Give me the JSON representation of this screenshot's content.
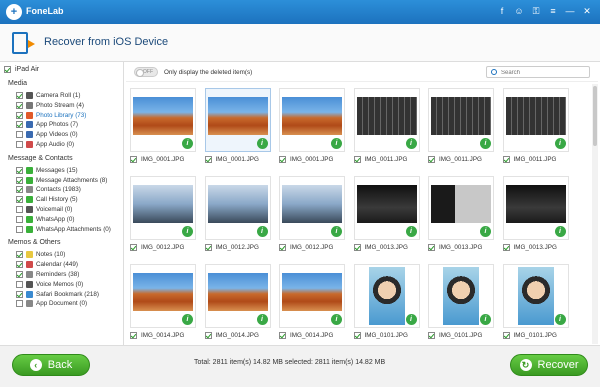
{
  "app": {
    "name": "FoneLab"
  },
  "title_icons": [
    "facebook-icon",
    "chat-icon",
    "key-icon",
    "list-icon",
    "minimize-icon",
    "close-icon"
  ],
  "title_icon_glyphs": [
    "f",
    "☺",
    "⚿",
    "≡",
    "—",
    "✕"
  ],
  "header": {
    "title": "Recover from iOS Device"
  },
  "sidebar": {
    "device": "iPad Air",
    "categories": [
      {
        "label": "Media",
        "items": [
          {
            "label": "Camera Roll (1)",
            "icon": "camera-icon",
            "color": "#555555",
            "checked": true
          },
          {
            "label": "Photo Stream (4)",
            "icon": "photo-stream-icon",
            "color": "#777777",
            "checked": true
          },
          {
            "label": "Photo Library (73)",
            "icon": "photo-library-icon",
            "color": "#e05a2a",
            "checked": true,
            "selected": true
          },
          {
            "label": "App Photos (7)",
            "icon": "app-photos-icon",
            "color": "#3a6ab0",
            "checked": true
          },
          {
            "label": "App Videos (0)",
            "icon": "app-videos-icon",
            "color": "#3a6ab0",
            "checked": false
          },
          {
            "label": "App Audio (0)",
            "icon": "app-audio-icon",
            "color": "#d04a4a",
            "checked": false
          }
        ]
      },
      {
        "label": "Message & Contacts",
        "items": [
          {
            "label": "Messages (15)",
            "icon": "messages-icon",
            "color": "#3ab03a",
            "checked": true
          },
          {
            "label": "Message Attachments (8)",
            "icon": "attachments-icon",
            "color": "#3ab03a",
            "checked": true
          },
          {
            "label": "Contacts (1983)",
            "icon": "contacts-icon",
            "color": "#888888",
            "checked": true
          },
          {
            "label": "Call History (5)",
            "icon": "phone-icon",
            "color": "#3ab03a",
            "checked": true
          },
          {
            "label": "Voicemail (0)",
            "icon": "voicemail-icon",
            "color": "#555555",
            "checked": false
          },
          {
            "label": "WhatsApp (0)",
            "icon": "whatsapp-icon",
            "color": "#3ab03a",
            "checked": false
          },
          {
            "label": "WhatsApp Attachments (0)",
            "icon": "whatsapp-attachments-icon",
            "color": "#3ab03a",
            "checked": false
          }
        ]
      },
      {
        "label": "Memos & Others",
        "items": [
          {
            "label": "Notes (10)",
            "icon": "notes-icon",
            "color": "#e8c840",
            "checked": true
          },
          {
            "label": "Calendar (449)",
            "icon": "calendar-icon",
            "color": "#d04a4a",
            "checked": true
          },
          {
            "label": "Reminders (38)",
            "icon": "reminders-icon",
            "color": "#888888",
            "checked": true
          },
          {
            "label": "Voice Memos (0)",
            "icon": "voice-memos-icon",
            "color": "#555555",
            "checked": false
          },
          {
            "label": "Safari Bookmark (218)",
            "icon": "safari-icon",
            "color": "#3a8ad0",
            "checked": true
          },
          {
            "label": "App Document (0)",
            "icon": "app-document-icon",
            "color": "#888888",
            "checked": false
          }
        ]
      }
    ]
  },
  "toolbar": {
    "toggle_label": "OFF",
    "only_label": "Only display the deleted item(s)",
    "search_placeholder": "Search"
  },
  "photos": [
    {
      "name": "IMG_0001.JPG",
      "kind": "desert"
    },
    {
      "name": "IMG_0001.JPG",
      "kind": "desert",
      "selected": true
    },
    {
      "name": "IMG_0001.JPG",
      "kind": "desert"
    },
    {
      "name": "IMG_0011.JPG",
      "kind": "keyboard"
    },
    {
      "name": "IMG_0011.JPG",
      "kind": "keyboard"
    },
    {
      "name": "IMG_0011.JPG",
      "kind": "keyboard"
    },
    {
      "name": "IMG_0012.JPG",
      "kind": "ui"
    },
    {
      "name": "IMG_0012.JPG",
      "kind": "ui"
    },
    {
      "name": "IMG_0012.JPG",
      "kind": "ui"
    },
    {
      "name": "IMG_0013.JPG",
      "kind": "dark"
    },
    {
      "name": "IMG_0013.JPG",
      "kind": "darkui"
    },
    {
      "name": "IMG_0013.JPG",
      "kind": "dark"
    },
    {
      "name": "IMG_0014.JPG",
      "kind": "desert"
    },
    {
      "name": "IMG_0014.JPG",
      "kind": "desert"
    },
    {
      "name": "IMG_0014.JPG",
      "kind": "desert"
    },
    {
      "name": "IMG_0101.JPG",
      "kind": "girl"
    },
    {
      "name": "IMG_0101.JPG",
      "kind": "girl"
    },
    {
      "name": "IMG_0101.JPG",
      "kind": "girl"
    }
  ],
  "footer": {
    "back_label": "Back",
    "recover_label": "Recover",
    "status": "Total: 2811 item(s) 14.82 MB   selected: 2811 item(s) 14.82 MB"
  },
  "colors": {
    "titlebar": "#1c72be",
    "accent_green": "#3a9a22"
  }
}
